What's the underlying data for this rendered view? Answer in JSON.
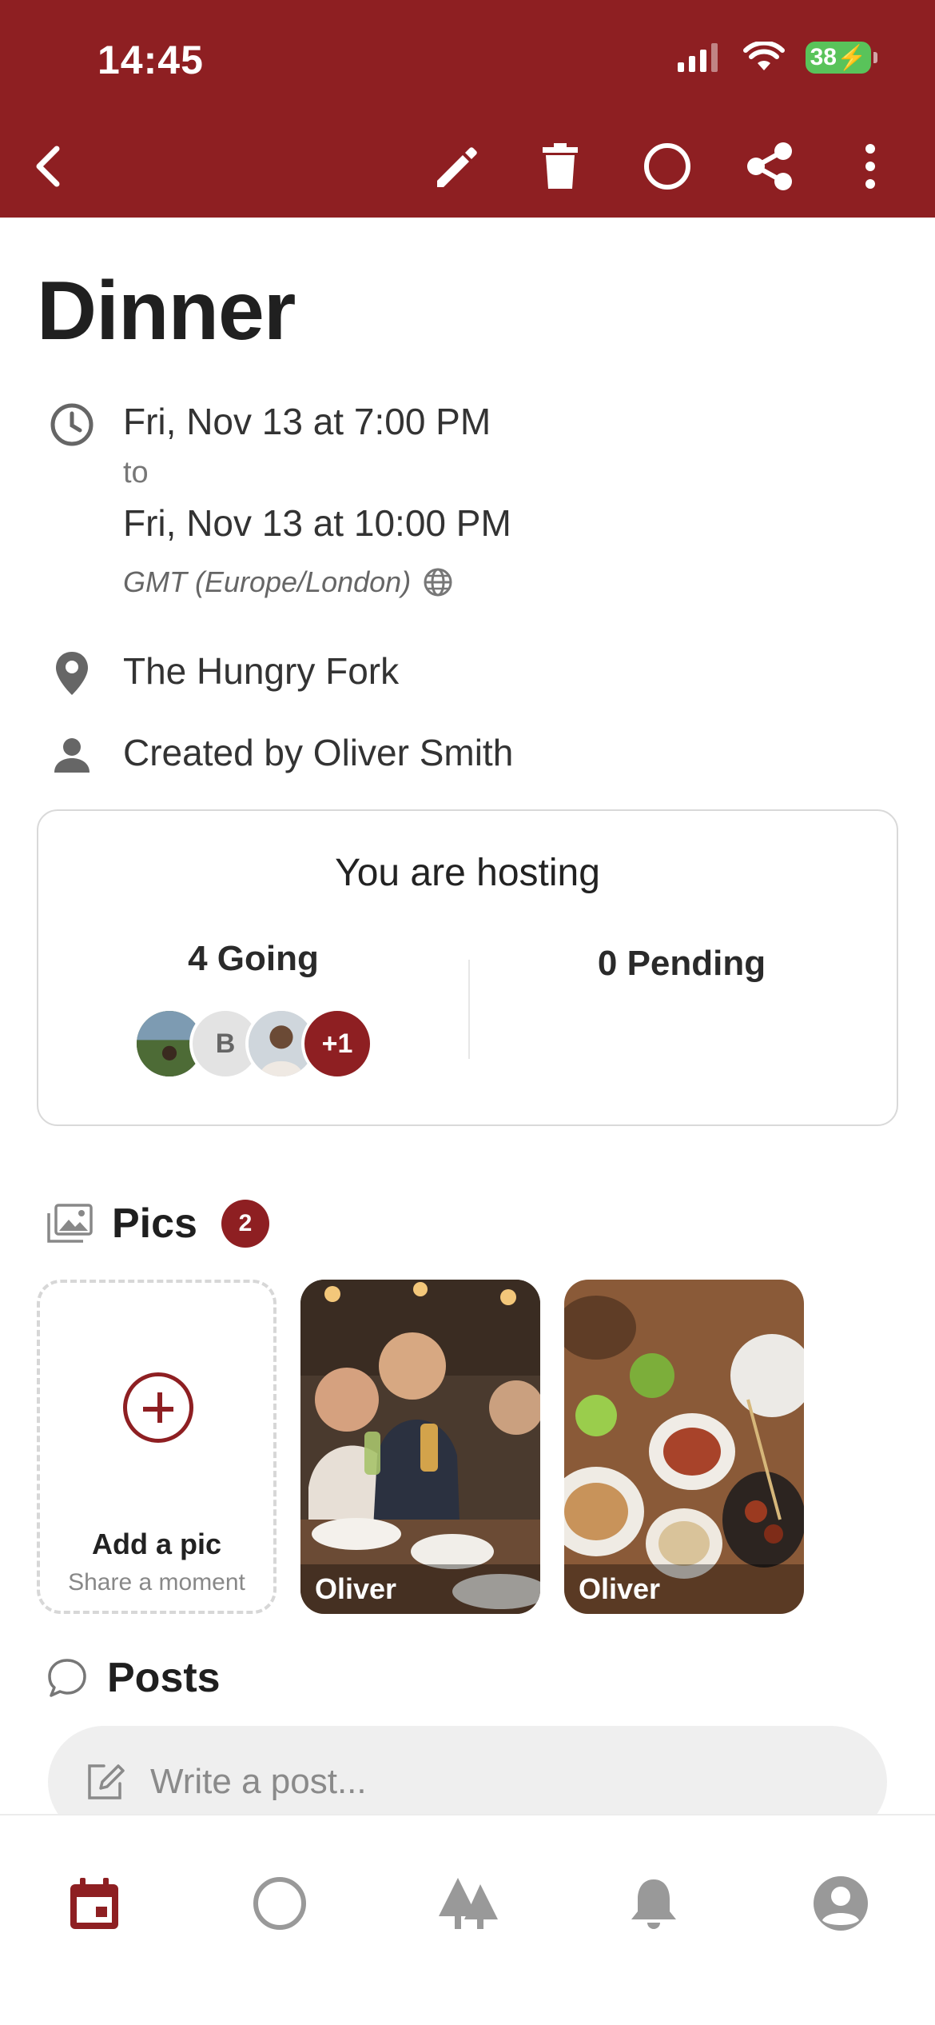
{
  "status_bar": {
    "time": "14:45",
    "battery": "38"
  },
  "header": {
    "back_icon": "chevron-left-icon",
    "actions": [
      "edit-icon",
      "trash-icon",
      "circle-icon",
      "share-icon",
      "more-vertical-icon"
    ]
  },
  "event": {
    "title": "Dinner",
    "start": "Fri, Nov 13 at 7:00 PM",
    "to_label": "to",
    "end": "Fri, Nov 13 at 10:00 PM",
    "timezone": "GMT (Europe/London)",
    "location": "The Hungry Fork",
    "created_by": "Created by Oliver Smith"
  },
  "hosting": {
    "title": "You are hosting",
    "going": "4 Going",
    "pending": "0 Pending",
    "avatars": [
      "",
      "B",
      "",
      "+1"
    ]
  },
  "pics": {
    "title": "Pics",
    "count": "2",
    "add_label": "Add a pic",
    "add_sub": "Share a moment",
    "photos": [
      {
        "owner": "Oliver"
      },
      {
        "owner": "Oliver"
      }
    ]
  },
  "posts": {
    "title": "Posts",
    "placeholder": "Write a post..."
  },
  "theme": {
    "brand": "#8e1f22",
    "accent_green": "#59c35a"
  }
}
